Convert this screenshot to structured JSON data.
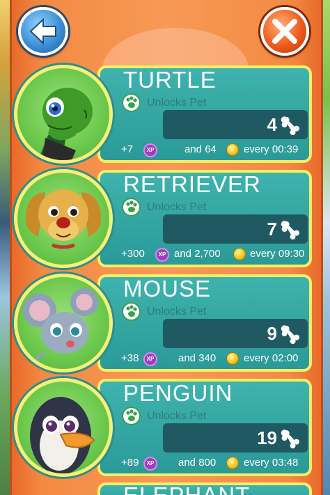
{
  "colors": {
    "panel_orange": "#f38a43",
    "card_teal": "#2a9a98",
    "card_border_yellow": "#f2ef6a",
    "count_box_dark": "#1f5a62",
    "xp_purple": "#9b3fbf",
    "coin_gold": "#f2c21c"
  },
  "toolbar": {
    "back_icon": "back-arrow-icon",
    "close_icon": "close-x-icon"
  },
  "pets": [
    {
      "name": "TURTLE",
      "unlock_label": "Unlocks Pet",
      "count": "4",
      "xp": "+7",
      "xp_badge": "XP",
      "and_label": "and 64",
      "every_label": "every 00:39",
      "icon": "turtle-icon"
    },
    {
      "name": "RETRIEVER",
      "unlock_label": "Unlocks Pet",
      "count": "7",
      "xp": "+300",
      "xp_badge": "XP",
      "and_label": "and 2,700",
      "every_label": "every 09:30",
      "icon": "retriever-icon"
    },
    {
      "name": "MOUSE",
      "unlock_label": "Unlocks Pet",
      "count": "9",
      "xp": "+38",
      "xp_badge": "XP",
      "and_label": "and 340",
      "every_label": "every 02:00",
      "icon": "mouse-icon"
    },
    {
      "name": "PENGUIN",
      "unlock_label": "Unlocks Pet",
      "count": "19",
      "xp": "+89",
      "xp_badge": "XP",
      "and_label": "and 800",
      "every_label": "every 03:48",
      "icon": "penguin-icon"
    },
    {
      "name": "ELEPHANT",
      "icon": "elephant-icon"
    }
  ]
}
